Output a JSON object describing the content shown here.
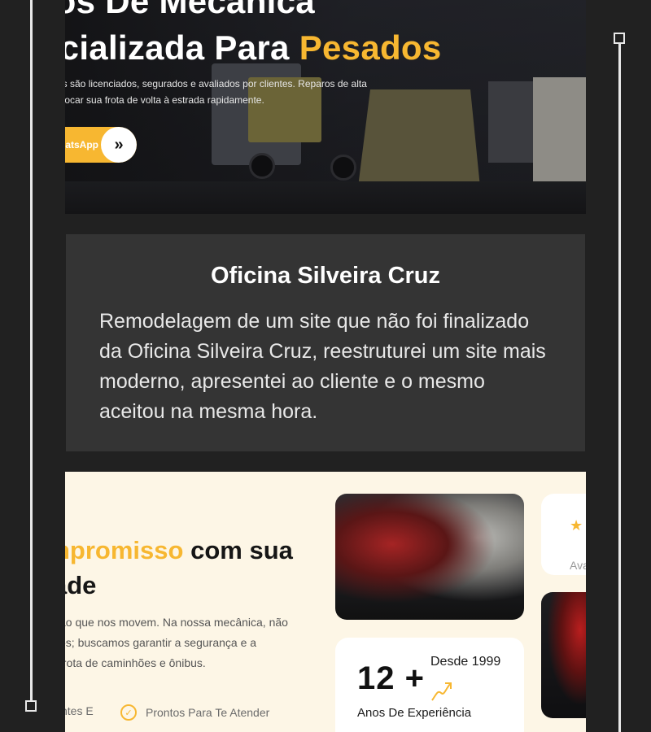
{
  "hero": {
    "title_line1": "iços De Mecânica",
    "title_line2_prefix": "ecializada Para",
    "title_line2_accent": "Pesados",
    "description_lines": [
      "os são licenciados, segurados e avaliados por clientes. Reparos de alta",
      "olocar sua frota de volta à estrada rapidamente."
    ],
    "whatsapp_button_label": "hatsApp",
    "arrow_glyph": "»"
  },
  "project_card": {
    "title": "Oficina Silveira Cruz",
    "description": "Remodelagem de um site que não foi finalizado da Oficina Silveira Cruz, reestruturei um site mais moderno, apresentei ao cliente e o mesmo aceitou na mesma hora."
  },
  "about": {
    "title_accent": "npromisso",
    "title_rest": "com sua",
    "title_line2": "ade",
    "description_lines": [
      "ão que nos movem. Na nossa mecânica, não",
      "os; buscamos garantir a segurança e a",
      "frota de caminhões e ônibus."
    ],
    "features": [
      "ntes E",
      "Prontos Para Te Atender"
    ],
    "stats": {
      "since": "Desde 1999",
      "number": "12 +",
      "label": "Anos De Experiência"
    },
    "rating_label": "Ava"
  },
  "colors": {
    "accent": "#f7b731",
    "page_background": "#212121",
    "card_background": "#343434",
    "section_background": "#fdf6e6"
  },
  "icons": {
    "check": "check-circle-icon",
    "star": "star-icon",
    "trend": "trend-arrow-icon",
    "arrow": "double-chevron-right-icon"
  }
}
